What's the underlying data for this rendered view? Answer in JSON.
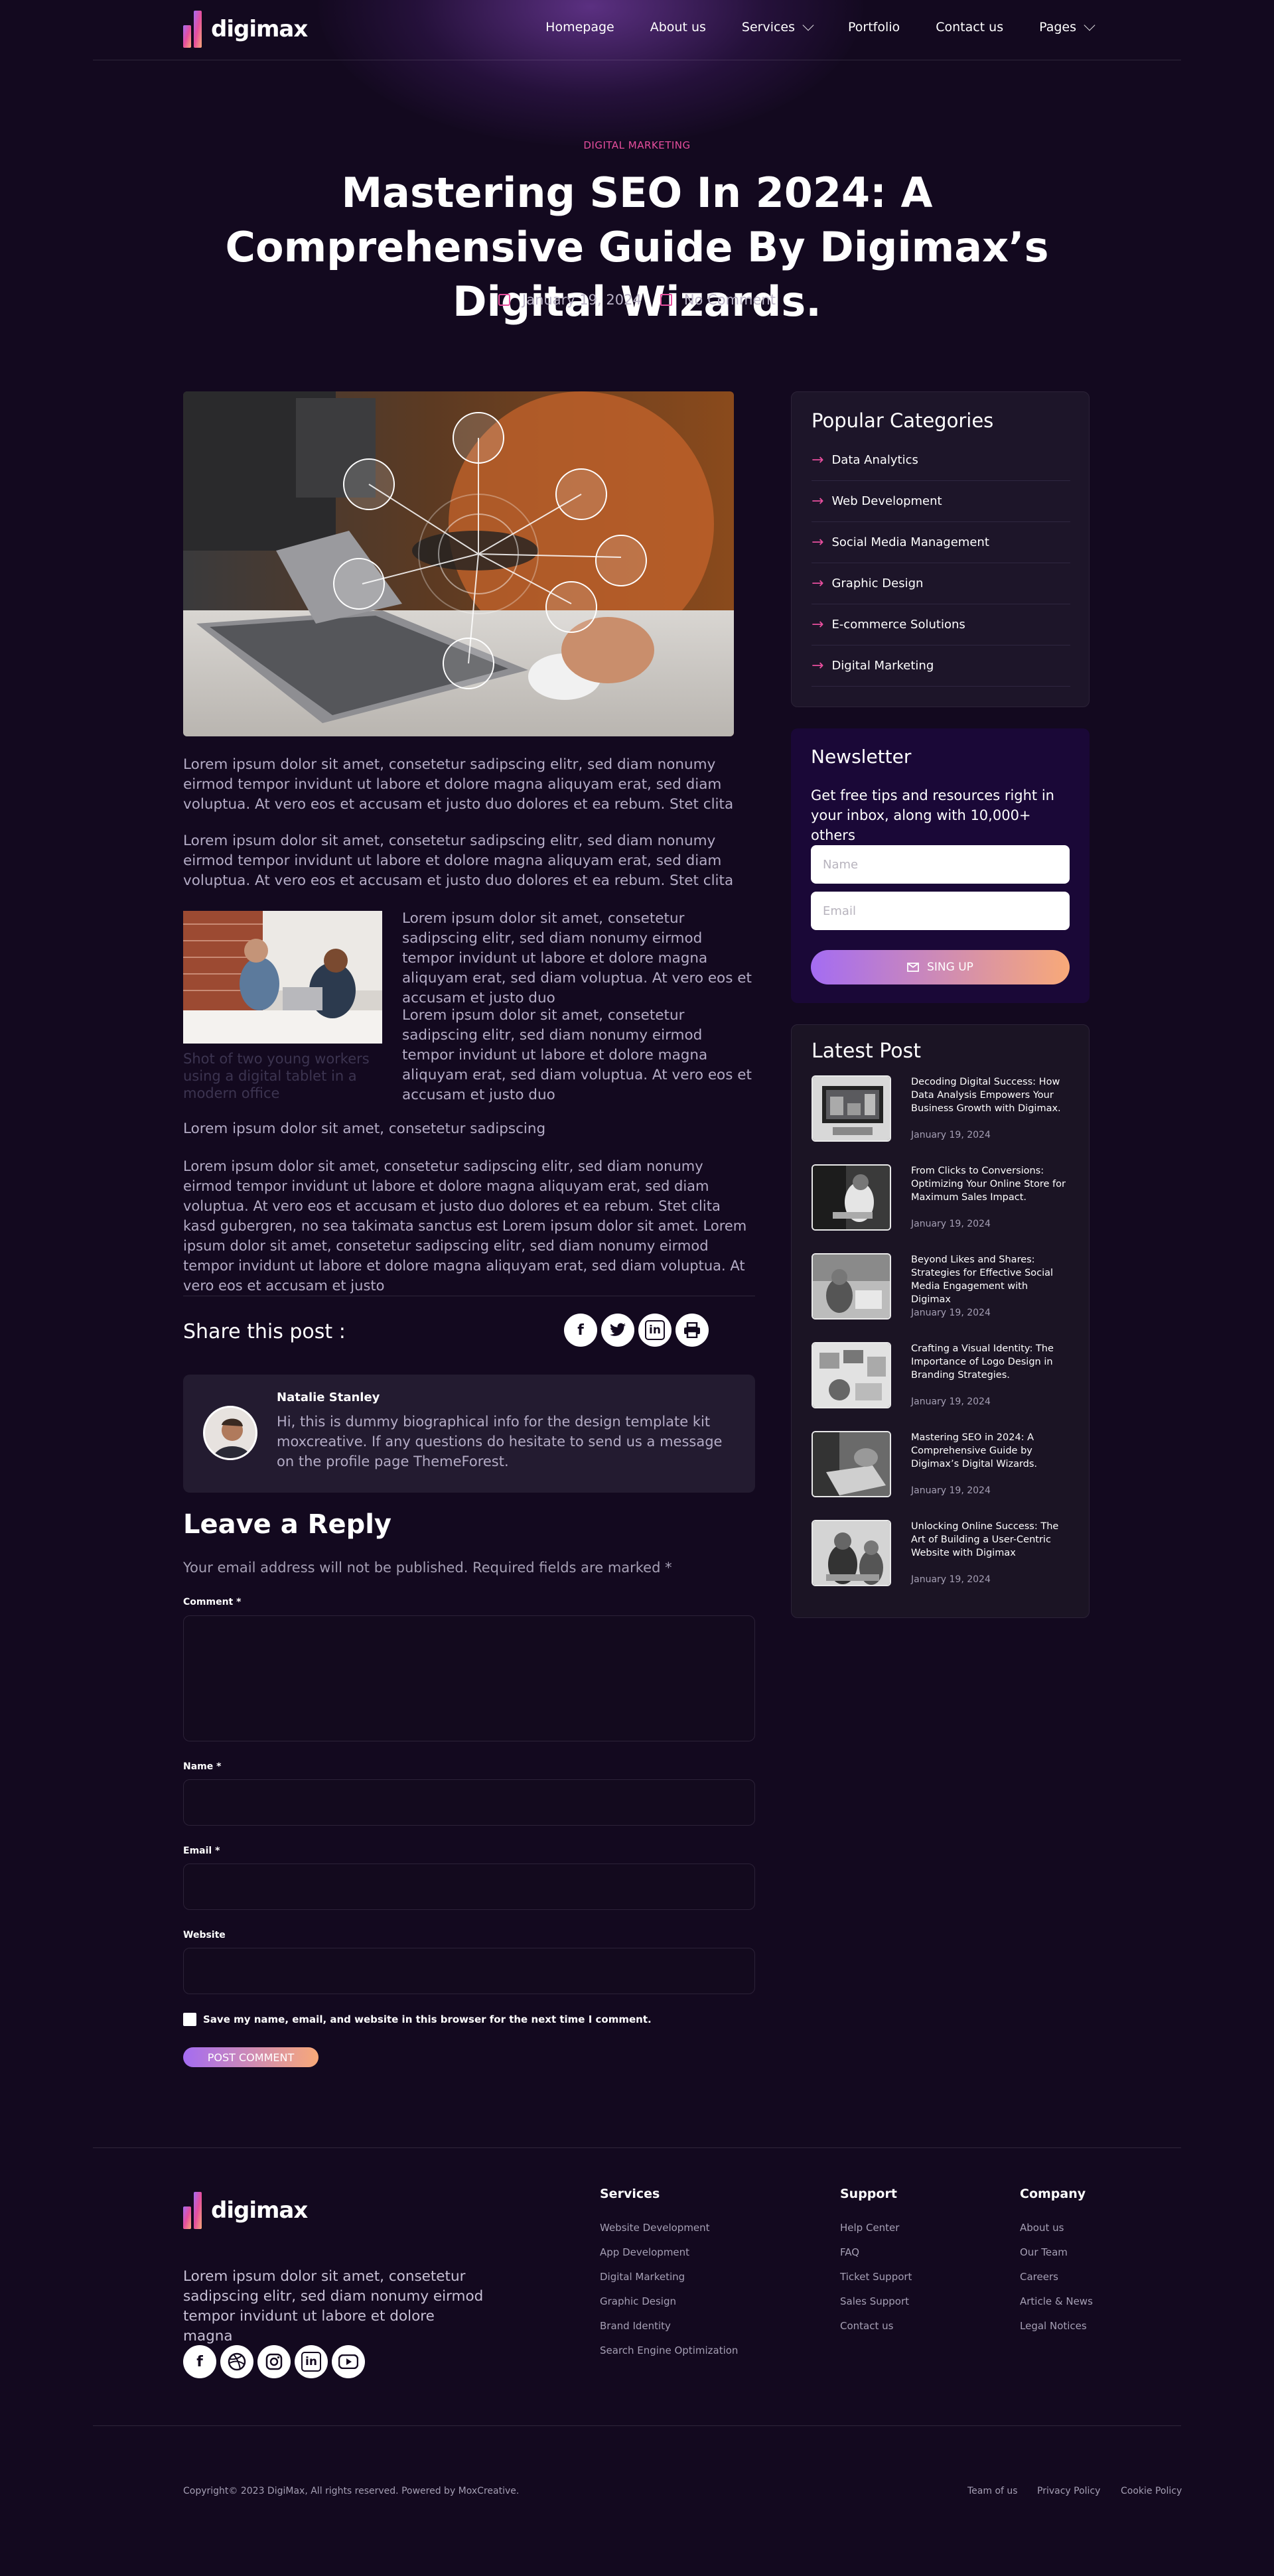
{
  "brand": {
    "name": "digimax",
    "gradient": [
      "#a46cf2",
      "#e64e9d",
      "#f8a978"
    ]
  },
  "nav": {
    "items": [
      {
        "label": "Homepage",
        "has_dropdown": false
      },
      {
        "label": "About us",
        "has_dropdown": false
      },
      {
        "label": "Services",
        "has_dropdown": true
      },
      {
        "label": "Portfolio",
        "has_dropdown": false
      },
      {
        "label": "Contact us",
        "has_dropdown": false
      },
      {
        "label": "Pages",
        "has_dropdown": true
      }
    ]
  },
  "post": {
    "category": "DIGITAL MARKETING",
    "title": "Mastering SEO In 2024: A Comprehensive Guide By Digimax’s Digital Wizards.",
    "date": "January 19, 2024",
    "comments": "No Comment",
    "paragraphs": [
      "Lorem ipsum dolor sit amet, consetetur sadipscing elitr, sed diam nonumy eirmod tempor invidunt ut labore et dolore magna aliquyam erat, sed diam voluptua. At vero eos et accusam et justo duo dolores et ea rebum. Stet clita",
      "Lorem ipsum dolor sit amet, consetetur sadipscing elitr, sed diam nonumy eirmod tempor invidunt ut labore et dolore magna aliquyam erat, sed diam voluptua. At vero eos et accusam et justo duo dolores et ea rebum. Stet clita",
      "Lorem ipsum dolor sit amet, consetetur sadipscing elitr, sed diam nonumy eirmod tempor invidunt ut labore et dolore magna aliquyam erat, sed diam voluptua. At vero eos et accusam et justo duo",
      "Lorem ipsum dolor sit amet, consetetur sadipscing elitr, sed diam nonumy eirmod tempor invidunt ut labore et dolore magna aliquyam erat, sed diam voluptua. At vero eos et accusam et justo duo",
      "Lorem ipsum dolor sit amet, consetetur sadipscing",
      "Lorem ipsum dolor sit amet, consetetur sadipscing elitr, sed diam nonumy eirmod tempor invidunt ut labore et dolore magna aliquyam erat, sed diam voluptua. At vero eos et accusam et justo duo dolores et ea rebum. Stet clita kasd gubergren, no sea takimata sanctus est Lorem ipsum dolor sit amet. Lorem ipsum dolor sit amet, consetetur sadipscing elitr, sed diam nonumy eirmod tempor invidunt ut labore et dolore magna aliquyam erat, sed diam voluptua. At vero eos et accusam et justo"
    ],
    "image_caption": "Shot of two young workers using a digital tablet in a modern office"
  },
  "share": {
    "label": "Share this post :",
    "icons": [
      "facebook-icon",
      "twitter-icon",
      "linkedin-icon",
      "print-icon"
    ]
  },
  "author": {
    "name": "Natalie Stanley",
    "bio": "Hi, this is dummy biographical info for the design template kit moxcreative. If any questions do hesitate to send us a message on the profile page ThemeForest."
  },
  "reply": {
    "title": "Leave a Reply",
    "note": "Your email address will not be published. Required fields are marked *",
    "comment_label": "Comment *",
    "name_label": "Name *",
    "email_label": "Email *",
    "website_label": "Website",
    "save_label": "Save my name, email, and website in this browser for the next time I comment.",
    "submit": "POST COMMENT"
  },
  "sidebar": {
    "categories_title": "Popular Categories",
    "categories": [
      "Data Analytics",
      "Web Development",
      "Social Media Management",
      "Graphic Design",
      "E-commerce Solutions",
      "Digital Marketing"
    ],
    "newsletter": {
      "title": "Newsletter",
      "text": "Get free tips and resources right in your inbox, along with 10,000+ others",
      "name_placeholder": "Name",
      "email_placeholder": "Email",
      "button": "SING UP"
    },
    "latest_title": "Latest Post",
    "latest": [
      {
        "title": "Decoding Digital Success: How Data Analysis Empowers Your Business Growth with Digimax.",
        "date": "January 19, 2024"
      },
      {
        "title": "From Clicks to Conversions: Optimizing Your Online Store for Maximum Sales Impact.",
        "date": "January 19, 2024"
      },
      {
        "title": "Beyond Likes and Shares: Strategies for Effective Social Media Engagement with Digimax",
        "date": "January 19, 2024"
      },
      {
        "title": "Crafting a Visual Identity: The Importance of Logo Design in Branding Strategies.",
        "date": "January 19, 2024"
      },
      {
        "title": "Mastering SEO in 2024: A Comprehensive Guide by Digimax’s Digital Wizards.",
        "date": "January 19, 2024"
      },
      {
        "title": "Unlocking Online Success: The Art of Building a User-Centric Website with Digimax",
        "date": "January 19, 2024"
      }
    ]
  },
  "footer": {
    "about": "Lorem ipsum dolor sit amet, consetetur sadipscing elitr, sed diam nonumy eirmod tempor invidunt ut labore et dolore magna",
    "social_icons": [
      "facebook-icon",
      "dribbble-icon",
      "instagram-icon",
      "linkedin-icon",
      "youtube-icon"
    ],
    "services_title": "Services",
    "services": [
      "Website Development",
      "App Development",
      "Digital Marketing",
      "Graphic Design",
      "Brand Identity",
      "Search Engine Optimization"
    ],
    "support_title": "Support",
    "support": [
      "Help Center",
      "FAQ",
      "Ticket Support",
      "Sales Support",
      "Contact us"
    ],
    "company_title": "Company",
    "company": [
      "About us",
      "Our Team",
      "Careers",
      "Article & News",
      "Legal Notices"
    ],
    "copyright": "Copyright© 2023 DigiMax, All rights reserved. Powered by MoxCreative.",
    "bottom_links": [
      "Team of us",
      "Privacy Policy",
      "Cookie Policy"
    ]
  }
}
